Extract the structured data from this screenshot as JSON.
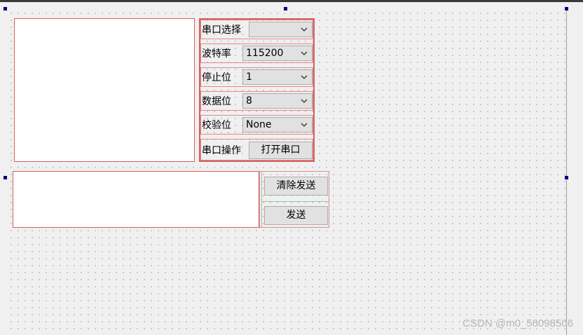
{
  "serial": {
    "port_label": "串口选择",
    "port_value": "",
    "baud_label": "波特率",
    "baud_value": "115200",
    "stop_label": "停止位",
    "stop_value": "1",
    "data_label": "数据位",
    "data_value": "8",
    "parity_label": "校验位",
    "parity_value": "None",
    "operate_label": "串口操作",
    "open_button": "打开串口"
  },
  "send": {
    "clear_button": "清除发送",
    "send_button": "发送"
  },
  "watermark": "CSDN @m0_56098506",
  "colors": {
    "layout_border": "#d45f5f",
    "selection_handle": "#000080"
  }
}
